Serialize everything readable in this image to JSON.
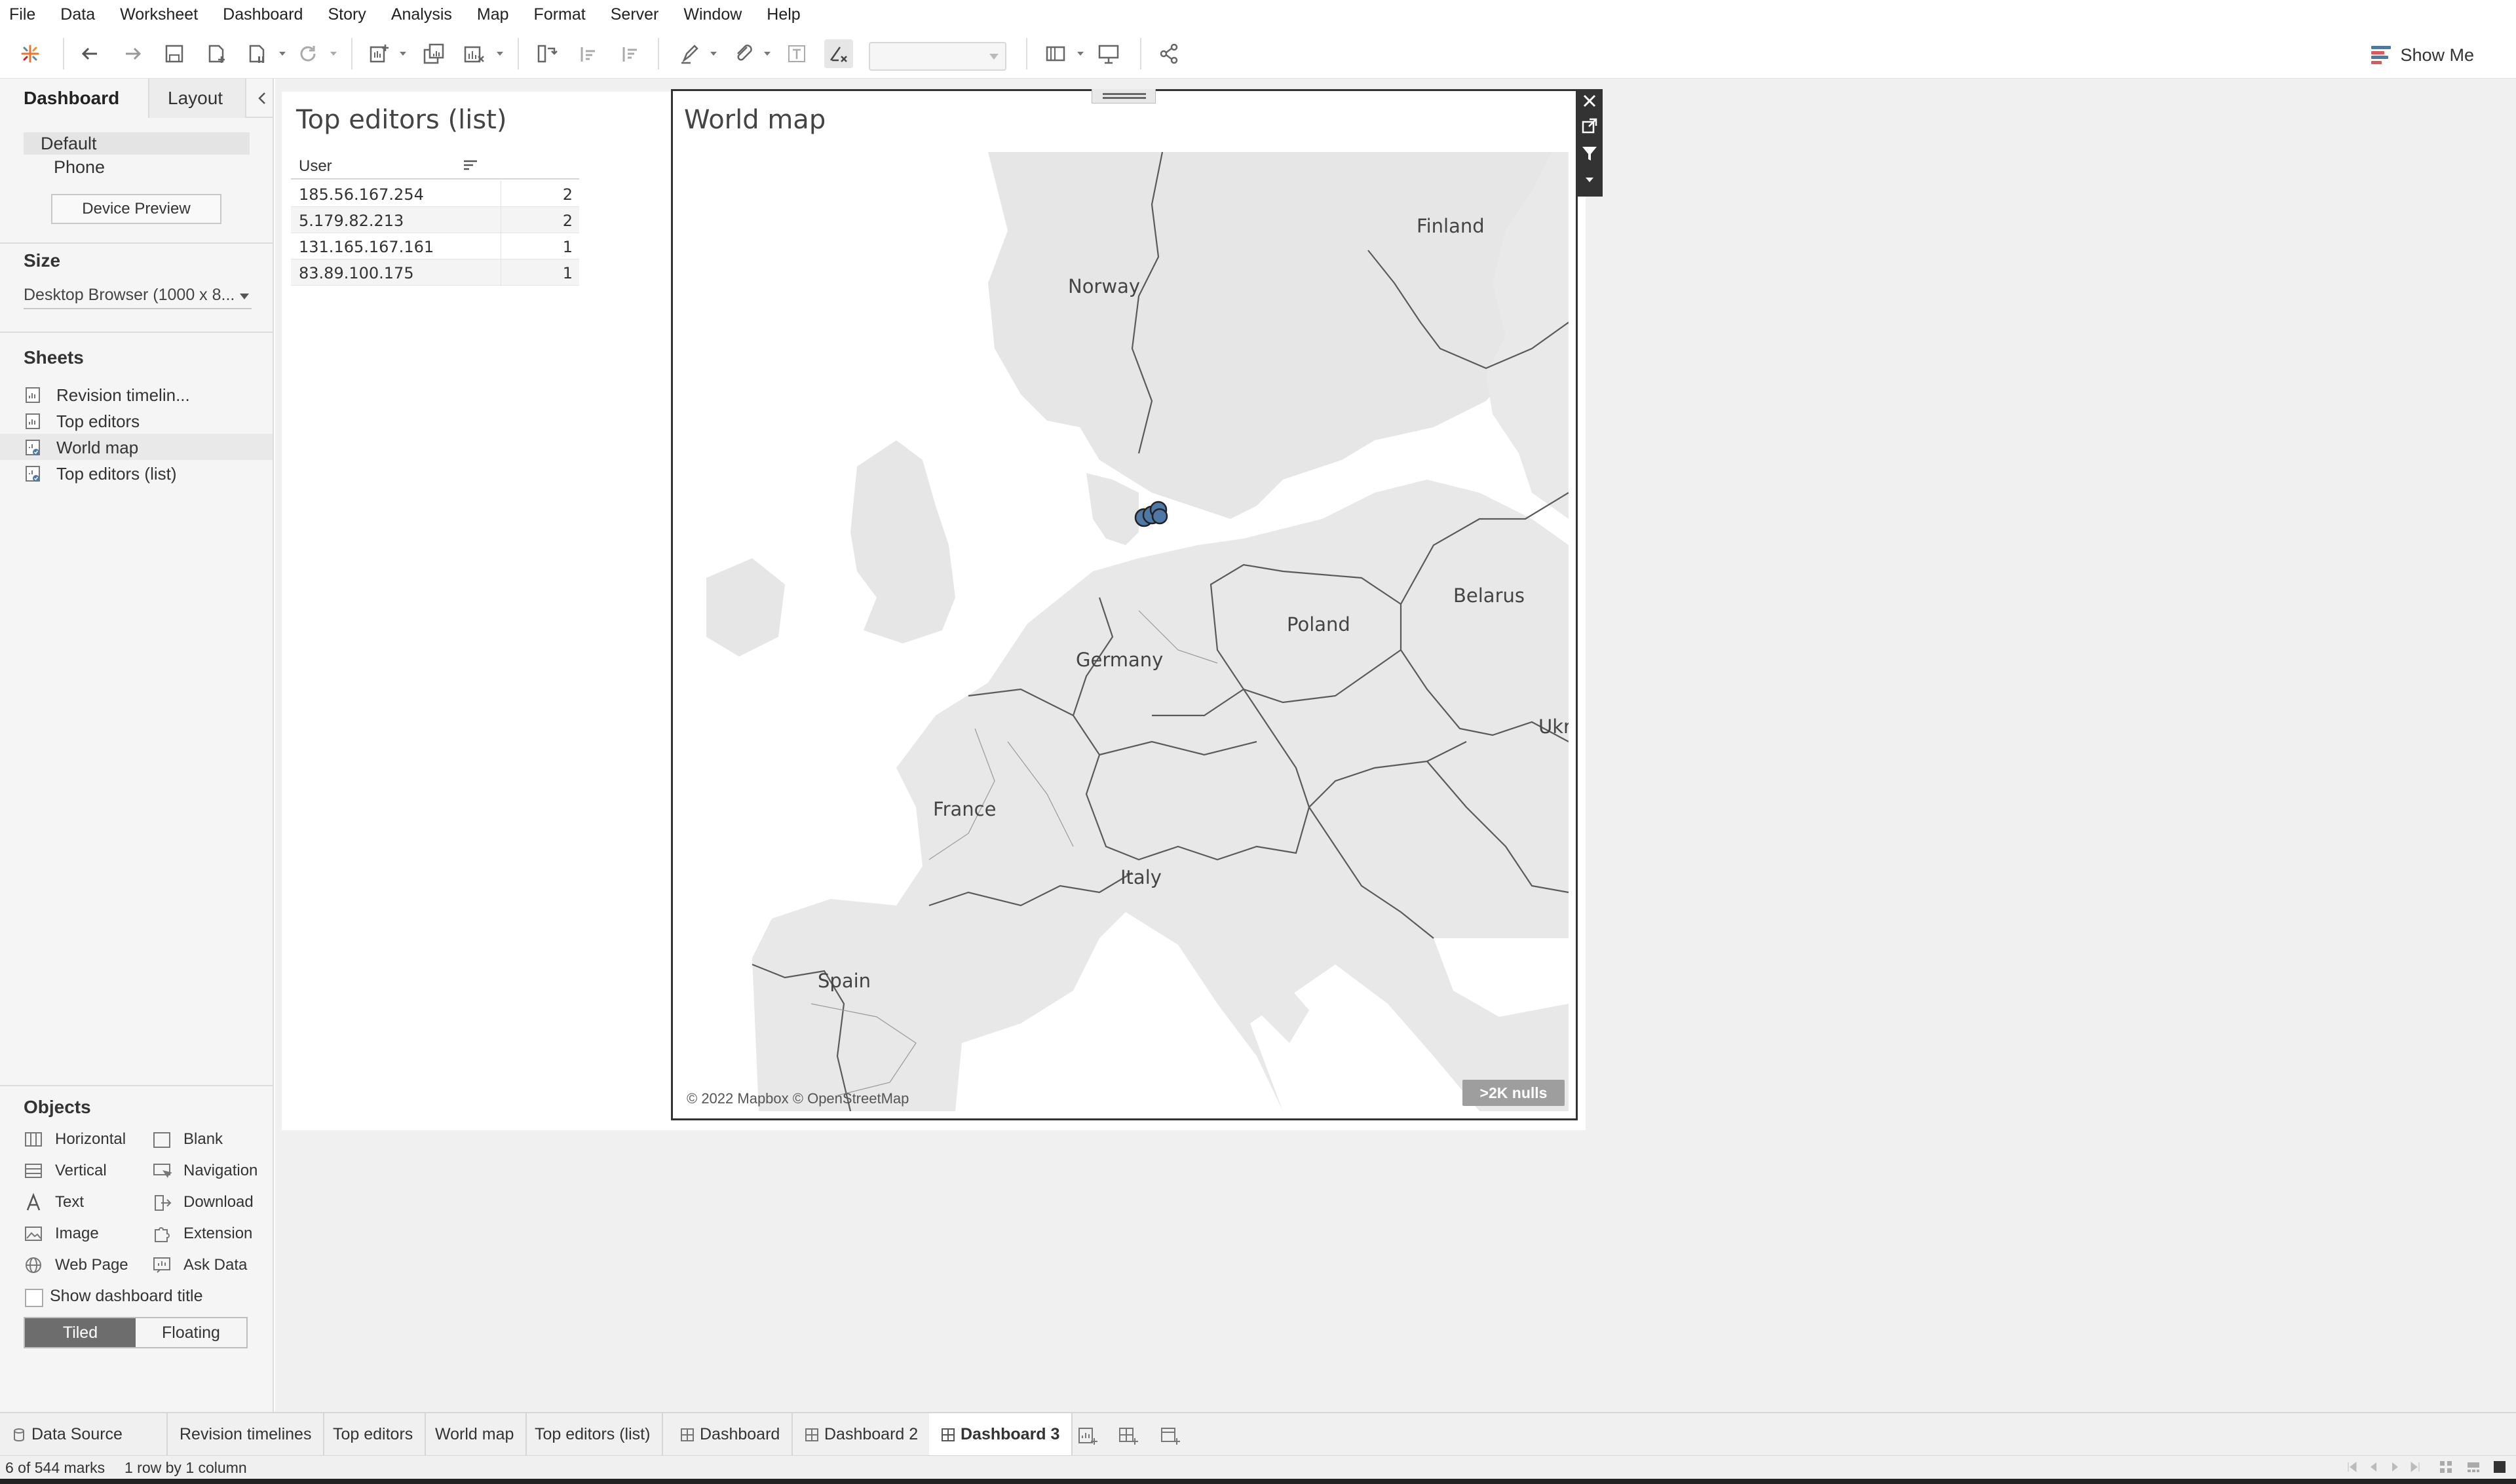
{
  "menu": [
    {
      "label": "File"
    },
    {
      "label": "Data"
    },
    {
      "label": "Worksheet"
    },
    {
      "label": "Dashboard"
    },
    {
      "label": "Story"
    },
    {
      "label": "Analysis"
    },
    {
      "label": "Map"
    },
    {
      "label": "Format"
    },
    {
      "label": "Server"
    },
    {
      "label": "Window"
    },
    {
      "label": "Help"
    }
  ],
  "toolbar": {
    "show_me_label": "Show Me",
    "icons": [
      "tableau-logo-icon",
      "undo-icon",
      "redo-icon",
      "save-icon",
      "new-data-source-icon",
      "pause-auto-updates-icon",
      "refresh-icon",
      "new-worksheet-icon",
      "duplicate-sheet-icon",
      "clear-sheet-icon",
      "swap-rows-columns-icon",
      "sort-ascending-icon",
      "sort-descending-icon",
      "highlight-icon",
      "group-members-icon",
      "show-mark-labels-icon",
      "fix-axes-icon",
      "fit-combo",
      "show-cards-icon",
      "presentation-mode-icon",
      "share-icon"
    ]
  },
  "left_panel": {
    "tabs": {
      "dashboard": "Dashboard",
      "layout": "Layout"
    },
    "devices": {
      "default": "Default",
      "phone": "Phone",
      "preview_button": "Device Preview"
    },
    "size": {
      "heading": "Size",
      "value": "Desktop Browser (1000 x 8..."
    },
    "sheets": {
      "heading": "Sheets",
      "items": [
        {
          "label": "Revision timelin...",
          "used": false
        },
        {
          "label": "Top editors",
          "used": false
        },
        {
          "label": "World map",
          "used": true
        },
        {
          "label": "Top editors (list)",
          "used": true
        }
      ]
    },
    "objects": {
      "heading": "Objects",
      "items": [
        {
          "label": "Horizontal",
          "icon": "horizontal-container-icon"
        },
        {
          "label": "Blank",
          "icon": "blank-icon"
        },
        {
          "label": "Vertical",
          "icon": "vertical-container-icon"
        },
        {
          "label": "Navigation",
          "icon": "navigation-icon"
        },
        {
          "label": "Text",
          "icon": "text-icon"
        },
        {
          "label": "Download",
          "icon": "download-icon"
        },
        {
          "label": "Image",
          "icon": "image-icon"
        },
        {
          "label": "Extension",
          "icon": "extension-icon"
        },
        {
          "label": "Web Page",
          "icon": "web-page-icon"
        },
        {
          "label": "Ask Data",
          "icon": "ask-data-icon"
        }
      ]
    },
    "layout_mode": {
      "tiled": "Tiled",
      "floating": "Floating",
      "selected": "Tiled"
    },
    "show_title_label": "Show dashboard title",
    "show_title_checked": false
  },
  "top_editors_list": {
    "title": "Top editors (list)",
    "column_header": "User",
    "rows": [
      {
        "user": "185.56.167.254",
        "count": "2"
      },
      {
        "user": "5.179.82.213",
        "count": "2"
      },
      {
        "user": "131.165.167.161",
        "count": "1"
      },
      {
        "user": "83.89.100.175",
        "count": "1"
      }
    ]
  },
  "world_map": {
    "title": "World map",
    "attribution": "© 2022 Mapbox © OpenStreetMap",
    "nulls_badge": ">2K nulls",
    "labels": [
      "Finland",
      "Norway",
      "Belarus",
      "Poland",
      "Germany",
      "Ukr",
      "France",
      "Italy",
      "Spain"
    ],
    "mark_color": "#4e79a7"
  },
  "bottom_tabs": [
    {
      "label": "Data Source",
      "icon": "data-source-icon",
      "active": false
    },
    {
      "label": "Revision timelines",
      "icon": "",
      "active": false
    },
    {
      "label": "Top editors",
      "icon": "",
      "active": false
    },
    {
      "label": "World map",
      "icon": "",
      "active": false
    },
    {
      "label": "Top editors (list)",
      "icon": "",
      "active": false
    },
    {
      "label": "Dashboard",
      "icon": "dashboard-icon",
      "active": false
    },
    {
      "label": "Dashboard 2",
      "icon": "dashboard-icon",
      "active": false
    },
    {
      "label": "Dashboard 3",
      "icon": "dashboard-icon",
      "active": true
    }
  ],
  "status": {
    "marks": "6 of 544 marks",
    "dims": "1 row by 1 column"
  }
}
